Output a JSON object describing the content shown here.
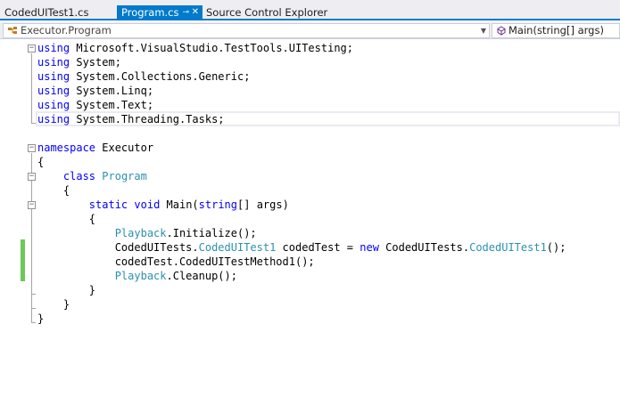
{
  "tabs": [
    {
      "label": "CodedUITest1.cs",
      "active": false
    },
    {
      "label": "Program.cs",
      "active": true
    },
    {
      "label": "Source Control Explorer",
      "active": false
    }
  ],
  "tab_icons": {
    "pin": "pin-icon",
    "close": "close-icon"
  },
  "navigation": {
    "type_combo": {
      "value": "Executor.Program",
      "icon": "class-icon"
    },
    "member_combo": {
      "value": "Main(string[] args)",
      "icon": "method-icon"
    }
  },
  "editor": {
    "lines": [
      {
        "tokens": [
          {
            "t": "using",
            "c": "kw"
          },
          {
            "t": " Microsoft.VisualStudio.TestTools.UITesting;",
            "c": ""
          }
        ]
      },
      {
        "tokens": [
          {
            "t": "using",
            "c": "kw"
          },
          {
            "t": " System;",
            "c": ""
          }
        ]
      },
      {
        "tokens": [
          {
            "t": "using",
            "c": "kw"
          },
          {
            "t": " System.Collections.Generic;",
            "c": ""
          }
        ]
      },
      {
        "tokens": [
          {
            "t": "using",
            "c": "kw"
          },
          {
            "t": " System.Linq;",
            "c": ""
          }
        ]
      },
      {
        "tokens": [
          {
            "t": "using",
            "c": "kw"
          },
          {
            "t": " System.Text;",
            "c": ""
          }
        ]
      },
      {
        "tokens": [
          {
            "t": "using",
            "c": "kw"
          },
          {
            "t": " System.Threading.Tasks;",
            "c": ""
          }
        ]
      },
      {
        "tokens": []
      },
      {
        "tokens": [
          {
            "t": "namespace",
            "c": "kw"
          },
          {
            "t": " Executor",
            "c": ""
          }
        ]
      },
      {
        "tokens": [
          {
            "t": "{",
            "c": ""
          }
        ]
      },
      {
        "tokens": [
          {
            "t": "    ",
            "c": ""
          },
          {
            "t": "class",
            "c": "kw"
          },
          {
            "t": " ",
            "c": ""
          },
          {
            "t": "Program",
            "c": "ty"
          }
        ]
      },
      {
        "tokens": [
          {
            "t": "    {",
            "c": ""
          }
        ]
      },
      {
        "tokens": [
          {
            "t": "        ",
            "c": ""
          },
          {
            "t": "static",
            "c": "kw"
          },
          {
            "t": " ",
            "c": ""
          },
          {
            "t": "void",
            "c": "kw"
          },
          {
            "t": " Main(",
            "c": ""
          },
          {
            "t": "string",
            "c": "kw"
          },
          {
            "t": "[] args)",
            "c": ""
          }
        ]
      },
      {
        "tokens": [
          {
            "t": "        {",
            "c": ""
          }
        ]
      },
      {
        "tokens": [
          {
            "t": "            ",
            "c": ""
          },
          {
            "t": "Playback",
            "c": "ty"
          },
          {
            "t": ".Initialize();",
            "c": ""
          }
        ]
      },
      {
        "tokens": [
          {
            "t": "            CodedUITests.",
            "c": ""
          },
          {
            "t": "CodedUITest1",
            "c": "ty"
          },
          {
            "t": " codedTest = ",
            "c": ""
          },
          {
            "t": "new",
            "c": "kw"
          },
          {
            "t": " CodedUITests.",
            "c": ""
          },
          {
            "t": "CodedUITest1",
            "c": "ty"
          },
          {
            "t": "();",
            "c": ""
          }
        ]
      },
      {
        "tokens": [
          {
            "t": "            codedTest.CodedUITestMethod1();",
            "c": ""
          }
        ]
      },
      {
        "tokens": [
          {
            "t": "            ",
            "c": ""
          },
          {
            "t": "Playback",
            "c": "ty"
          },
          {
            "t": ".Cleanup();",
            "c": ""
          }
        ]
      },
      {
        "tokens": [
          {
            "t": "        }",
            "c": ""
          }
        ]
      },
      {
        "tokens": [
          {
            "t": "    }",
            "c": ""
          }
        ]
      },
      {
        "tokens": [
          {
            "t": "}",
            "c": ""
          }
        ]
      }
    ]
  },
  "gutter": {
    "fold_glyph": "−",
    "change_marker_color": "#6ec857"
  },
  "colors": {
    "keyword": "#0000ff",
    "type": "#2b91af",
    "active_tab": "#007acc"
  }
}
